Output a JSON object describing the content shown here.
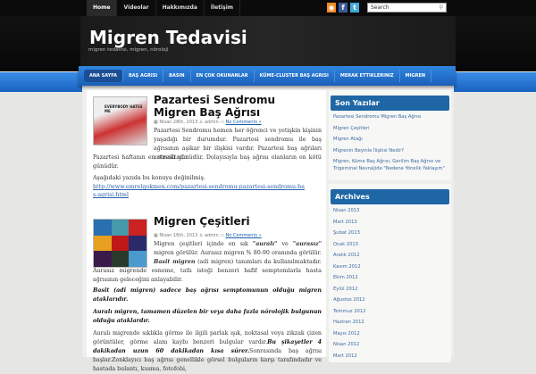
{
  "topnav": [
    "Home",
    "Videolar",
    "Hakkımızda",
    "İletişim"
  ],
  "search": {
    "placeholder": "Search"
  },
  "site": {
    "title": "Migren Tedavisi",
    "tagline": "migren tedavisi, migren, nöroloji"
  },
  "mainnav": [
    "ANA SAYFA",
    "BAŞ AGRISI",
    "BASIN",
    "EN ÇOK OKUNANLAR",
    "KÜME-CLUSTER BAŞ AGRISI",
    "MERAK ETTIKLERINIZ",
    "MIGREN"
  ],
  "posts": [
    {
      "title": "Pazartesi Sendromu Migren Baş Ağrısı",
      "date": "Nisan 28th, 2013",
      "author": "admin",
      "comments": "No Comments »",
      "image_text": "EVERYBODY HATES ME",
      "p1": "Pazartesi Sendromu hemen her öğrenci ve yetişkin kişinin yaşadığı bir durumdur.  Pazartesi sendromu ile baş ağrısının aşikar bir ilişkisi vardır. Pazartesi baş ağrıları artmaktadır.",
      "p1b": "Pazartesi haftanın en stresli günüdür. Dolayısıyla baş ağrısı olanların en kötü günüdür.",
      "p2": "Aşağıdaki yazıda bu konuya değinilmiş.",
      "link": "http://www.emrelgokmen.com/pazartesi-sendromu-pazartesi-sendromu-bas-agrisi.html"
    },
    {
      "title": "Migren Çeşitleri",
      "date": "Nisan 16th, 2013",
      "author": "admin",
      "comments": "No Comments »",
      "p1a": "Migren çeşitleri içinde en sık ",
      "b1": "\"auralı\"",
      "p1c": " ve ",
      "b2": "\"aurasız\"",
      "p1d": " migren görülür. Aurasız migren  % 80-90 oranında görülür. ",
      "b3": "Basit migren",
      "p1e": " (adi migren) tanımları da kullanılmaktadır. Aurasız migrende esneme, tatlı isteği benzeri hafif semptomlarla hasta ağrısının geleceğini anlayabilir.",
      "p2": "Basit (adi migren) sadece baş ağrısı semptomunun olduğu migren ataklarıdır.",
      "p3": "Auralı migren, tamamen düzelen bir veya daha fazla nörolojik bulgunun olduğu ataklardır.",
      "p4a": "Auralı migrende sıklıkla görme ile ilgili parlak ışık, noktasal veya zikzak çizen görüntüler, görme alanı kaybı benzeri bulgular vardır.",
      "b4": "Bu şikayetler 4 dakikadan uzun 60 dakikadan kısa sürer.",
      "p4b": "Sonrasında baş ağrısı başlar.Zonklayıcı baş ağrısı genellikle görsel bulguların karşı tarafındadır ve hastada bulantı, kusma, fotofobi,"
    }
  ],
  "sidebar": {
    "recent_title": "Son Yazılar",
    "recent": [
      "Pazartesi Sendromu Migren Baş Ağrısı",
      "Migren Çeşitleri",
      "Migren Atağı",
      "Migrenin Beyinle İlişkisi Nedir?",
      "Migren, Küme Baş Ağrısı, Gerilim Baş Ağrısı ve Trigeminal Nevraljide \"Nedene Yönelik Yaklaşım\""
    ],
    "archives_title": "Archives",
    "archives": [
      "Nisan 2013",
      "Mart 2013",
      "Şubat 2013",
      "Ocak 2013",
      "Aralık 2012",
      "Kasım 2012",
      "Ekim 2012",
      "Eylül 2012",
      "Ağustos 2012",
      "Temmuz 2012",
      "Haziran 2012",
      "Mayıs 2012",
      "Nisan 2012",
      "Mart 2012"
    ]
  }
}
